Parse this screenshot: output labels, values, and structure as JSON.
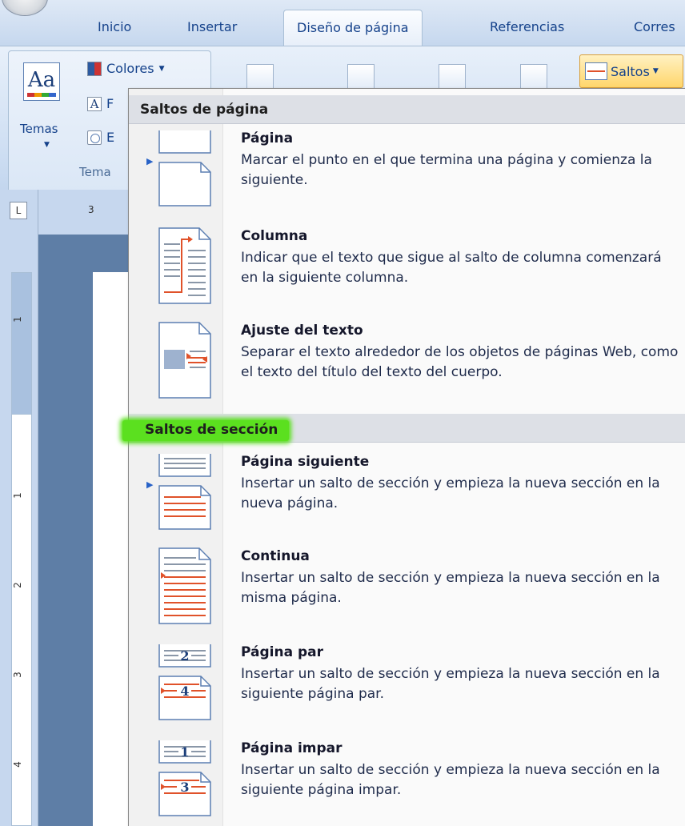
{
  "tabs": {
    "inicio": "Inicio",
    "insertar": "Insertar",
    "diseno": "Diseño de página",
    "referencias": "Referencias",
    "correspondencia": "Corres"
  },
  "ribbon": {
    "temas_label": "Temas",
    "colores_label": "Colores",
    "fuentes_label": "F",
    "efectos_label": "E",
    "tema_group_label": "Tema",
    "saltos_label": "Saltos"
  },
  "ruler": {
    "corner": "L",
    "h_number": "3",
    "v_numbers": [
      "1",
      "1",
      "2",
      "3",
      "4"
    ]
  },
  "menu": {
    "page_breaks_header": "Saltos de página",
    "section_breaks_header": "Saltos de sección",
    "items": [
      {
        "title": "Página",
        "desc": "Marcar el punto en el que termina una página y comienza la siguiente."
      },
      {
        "title": "Columna",
        "desc": "Indicar que el texto que sigue al salto de columna comenzará en la siguiente columna."
      },
      {
        "title": "Ajuste del texto",
        "desc": "Separar el texto alrededor de los objetos de páginas Web, como el texto del título del texto del cuerpo."
      },
      {
        "title": "Página siguiente",
        "desc": "Insertar un salto de sección y empieza la nueva sección en la nueva página."
      },
      {
        "title": "Continua",
        "desc": "Insertar un salto de sección y empieza la nueva sección en la misma página."
      },
      {
        "title": "Página par",
        "desc": "Insertar un salto de sección y empieza la nueva sección en la siguiente página par."
      },
      {
        "title": "Página impar",
        "desc": "Insertar un salto de sección y empieza la nueva sección en la siguiente página impar."
      }
    ]
  },
  "colors": {
    "highlight": "#5be01f",
    "break_red": "#e0522a",
    "ribbon_text": "#15428b"
  }
}
